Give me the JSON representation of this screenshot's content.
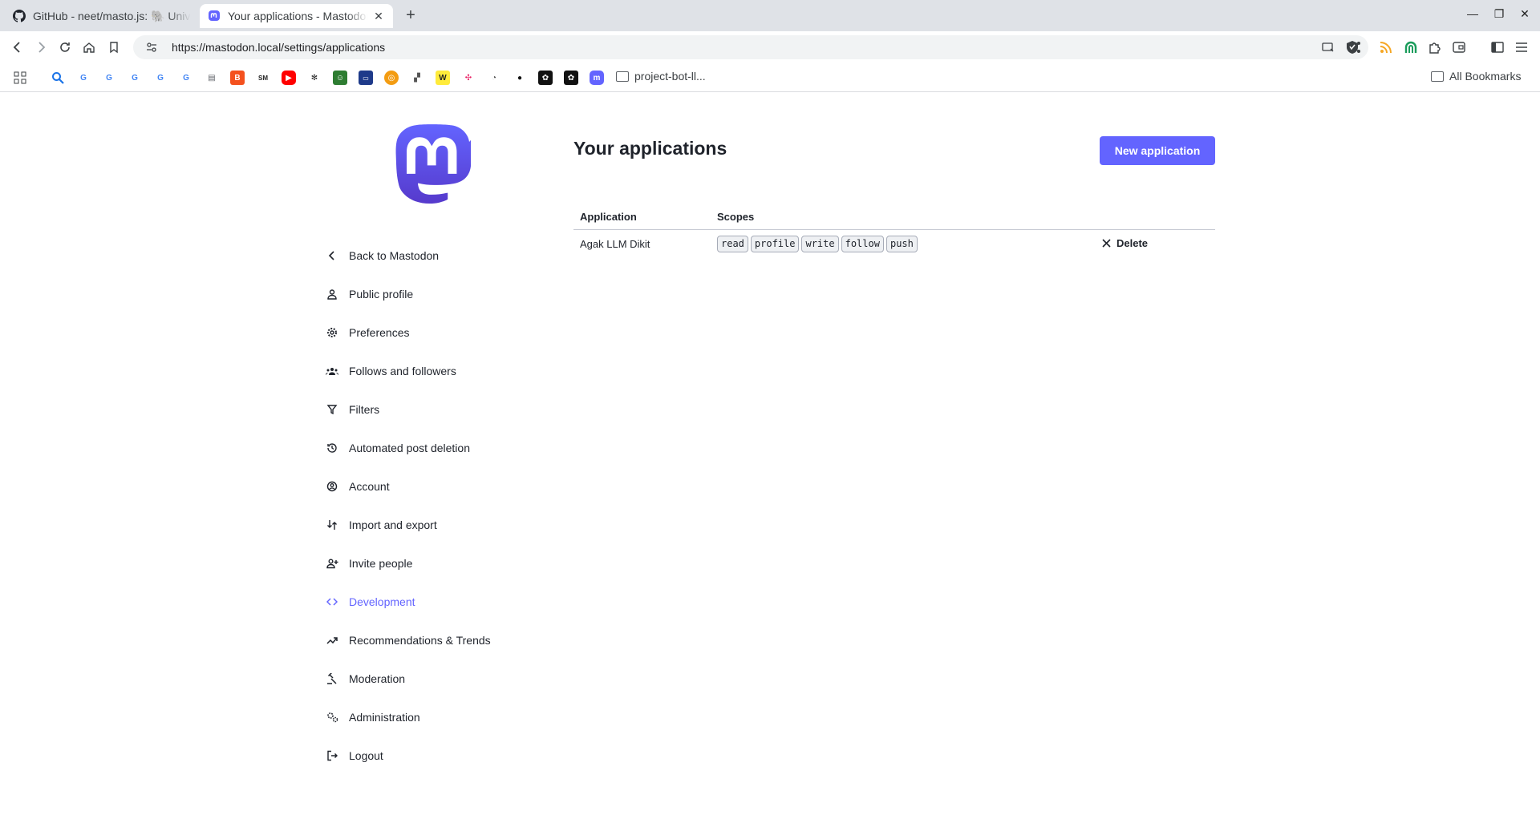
{
  "browser": {
    "tabs": [
      {
        "title": "GitHub - neet/masto.js: 🐘 Universal Mastodon API client",
        "icon": "github-icon",
        "active": false
      },
      {
        "title": "Your applications - Mastodon",
        "icon": "mastodon-icon",
        "active": true
      }
    ],
    "url": "https://mastodon.local/settings/applications",
    "bookmark_folder": "project-bot-ll...",
    "all_bookmarks": "All Bookmarks"
  },
  "sidebar": {
    "items": [
      {
        "label": "Back to Mastodon",
        "icon": "chevron-left-icon"
      },
      {
        "label": "Public profile",
        "icon": "person-icon"
      },
      {
        "label": "Preferences",
        "icon": "gear-icon"
      },
      {
        "label": "Follows and followers",
        "icon": "people-icon"
      },
      {
        "label": "Filters",
        "icon": "filter-icon"
      },
      {
        "label": "Automated post deletion",
        "icon": "history-icon"
      },
      {
        "label": "Account",
        "icon": "account-circle-icon"
      },
      {
        "label": "Import and export",
        "icon": "import-export-icon"
      },
      {
        "label": "Invite people",
        "icon": "person-add-icon"
      },
      {
        "label": "Development",
        "icon": "code-icon",
        "active": true
      },
      {
        "label": "Recommendations & Trends",
        "icon": "trending-icon"
      },
      {
        "label": "Moderation",
        "icon": "gavel-icon"
      },
      {
        "label": "Administration",
        "icon": "admin-gear-icon"
      },
      {
        "label": "Logout",
        "icon": "logout-icon"
      }
    ]
  },
  "main": {
    "title": "Your applications",
    "new_button": "New application",
    "table": {
      "headers": [
        "Application",
        "Scopes",
        ""
      ],
      "rows": [
        {
          "name": "Agak LLM Dikit",
          "scopes": [
            "read",
            "profile",
            "write",
            "follow",
            "push"
          ],
          "action": "Delete"
        }
      ]
    }
  },
  "colors": {
    "accent": "#6364ff",
    "text": "#1f232b"
  }
}
